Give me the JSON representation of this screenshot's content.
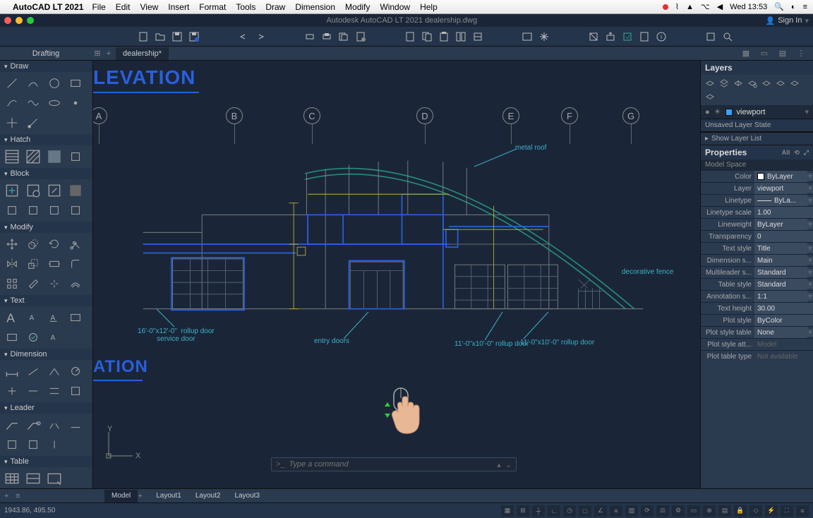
{
  "menubar": {
    "appname": "AutoCAD LT 2021",
    "items": [
      "File",
      "Edit",
      "View",
      "Insert",
      "Format",
      "Tools",
      "Draw",
      "Dimension",
      "Modify",
      "Window",
      "Help"
    ],
    "time": "Wed 13:53"
  },
  "titlebar": {
    "center": "Autodesk AutoCAD LT 2021    dealership.dwg",
    "signin": "Sign In"
  },
  "workspace": {
    "label": "Drafting",
    "doc_tab": "dealership*"
  },
  "left_palette": {
    "sections": [
      "Draw",
      "Hatch",
      "Block",
      "Modify",
      "Text",
      "Dimension",
      "Leader",
      "Table"
    ]
  },
  "canvas": {
    "heading1": "LEVATION",
    "heading2": "ATION",
    "gridmarks": [
      "A",
      "B",
      "C",
      "D",
      "E",
      "F",
      "G"
    ],
    "annotations": {
      "metal_roof": "metal roof",
      "decorative_fence": "decorative fence",
      "door1": "16'-0\"x12'-0\"  rollup door\nservice door",
      "door2": "entry doors",
      "door3": "11'-0\"x10'-0\"  rollup door",
      "door4": "11'-0\"x10'-0\"  rollup door"
    },
    "ucs": {
      "x": "X",
      "y": "Y"
    },
    "cmd_placeholder": "Type a command"
  },
  "layers": {
    "title": "Layers",
    "current": "viewport",
    "state": "Unsaved Layer State",
    "showlist": "Show Layer List"
  },
  "properties": {
    "title": "Properties",
    "subtitle": "Model Space",
    "rows": [
      {
        "lbl": "Color",
        "val": "ByLayer",
        "swatch": true,
        "dd": true
      },
      {
        "lbl": "Layer",
        "val": "viewport",
        "dd": true
      },
      {
        "lbl": "Linetype",
        "val": "ByLa...",
        "dd": true,
        "ltline": true
      },
      {
        "lbl": "Linetype scale",
        "val": "1.00"
      },
      {
        "lbl": "Lineweight",
        "val": "ByLayer",
        "dd": true
      },
      {
        "lbl": "Transparency",
        "val": "0"
      },
      {
        "lbl": "Text style",
        "val": "Title",
        "dd": true
      },
      {
        "lbl": "Dimension s...",
        "val": "Main",
        "dd": true
      },
      {
        "lbl": "Multileader s...",
        "val": "Standard",
        "dd": true
      },
      {
        "lbl": "Table style",
        "val": "Standard",
        "dd": true
      },
      {
        "lbl": "Annotation s...",
        "val": "1:1",
        "dd": true
      },
      {
        "lbl": "Text height",
        "val": "30.00"
      },
      {
        "lbl": "Plot style",
        "val": "ByColor"
      },
      {
        "lbl": "Plot style table",
        "val": "None",
        "dd": true
      },
      {
        "lbl": "Plot style att...",
        "val": "Model",
        "dim": true
      },
      {
        "lbl": "Plot table type",
        "val": "Not available",
        "dim": true
      }
    ]
  },
  "tabs": {
    "items": [
      "Model",
      "Layout1",
      "Layout2",
      "Layout3"
    ],
    "active": 0
  },
  "status": {
    "coords": "1943.86, 495.50"
  }
}
